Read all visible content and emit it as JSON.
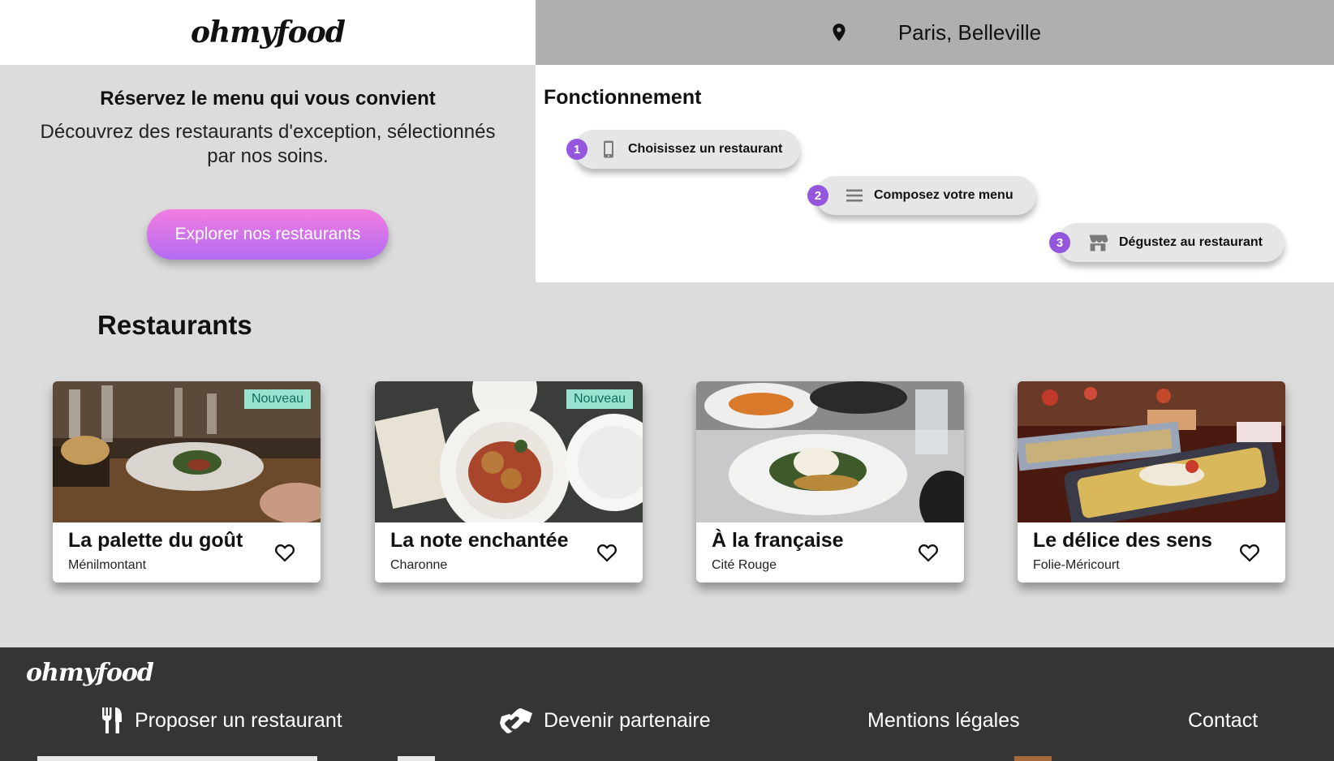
{
  "header": {
    "logo": "ohmyfood",
    "location_icon": "map-pin-icon",
    "location": "Paris, Belleville"
  },
  "hero": {
    "title": "Réservez le menu qui vous convient",
    "subtitle": "Découvrez des restaurants d'exception, sélectionnés par nos soins.",
    "cta_label": "Explorer nos restaurants",
    "cta_gradient": [
      "#f37ce0",
      "#b36cf3"
    ]
  },
  "how_it_works": {
    "title": "Fonctionnement",
    "steps": [
      {
        "number": "1",
        "icon": "smartphone-icon",
        "label": "Choisissez un restaurant"
      },
      {
        "number": "2",
        "icon": "list-icon",
        "label": "Composez votre menu"
      },
      {
        "number": "3",
        "icon": "store-icon",
        "label": "Dégustez au restaurant"
      }
    ],
    "accent_color": "#9356dc"
  },
  "restaurants": {
    "title": "Restaurants",
    "items": [
      {
        "name": "La palette du goût",
        "area": "Ménilmontant",
        "badge": "Nouveau",
        "favorite_icon": "heart-outline-icon"
      },
      {
        "name": "La note enchantée",
        "area": "Charonne",
        "badge": "Nouveau",
        "favorite_icon": "heart-outline-icon"
      },
      {
        "name": "À la française",
        "area": "Cité Rouge",
        "badge": "",
        "favorite_icon": "heart-outline-icon"
      },
      {
        "name": "Le délice des sens",
        "area": "Folie-Méricourt",
        "badge": "",
        "favorite_icon": "heart-outline-icon"
      }
    ],
    "badge_color": "#99e2d0"
  },
  "footer": {
    "logo": "ohmyfood",
    "links": [
      {
        "icon": "utensils-icon",
        "label": "Proposer un restaurant"
      },
      {
        "icon": "handshake-icon",
        "label": "Devenir partenaire"
      },
      {
        "icon": "",
        "label": "Mentions légales"
      },
      {
        "icon": "",
        "label": "Contact"
      }
    ],
    "background": "#353535"
  }
}
